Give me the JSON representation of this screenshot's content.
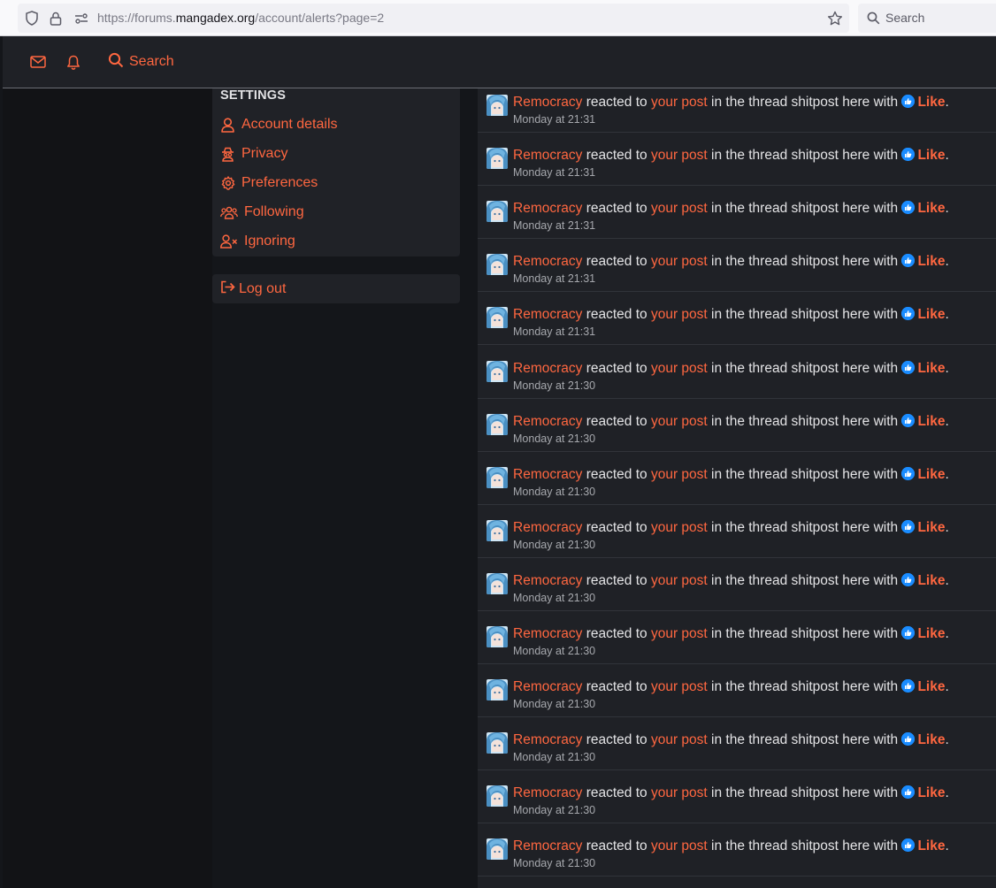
{
  "browser": {
    "url_prefix": "https://forums.",
    "url_domain": "mangadex.org",
    "url_path": "/account/alerts?page=2",
    "search_placeholder": "Search"
  },
  "nav": {
    "search_label": "Search",
    "icons": [
      "mail-icon",
      "bell-icon",
      "search-icon"
    ],
    "accent_color": "#ff6740"
  },
  "settings": {
    "title": "SETTINGS",
    "items": [
      {
        "label": "Account details",
        "icon": "user-icon"
      },
      {
        "label": "Privacy",
        "icon": "spy-icon"
      },
      {
        "label": "Preferences",
        "icon": "gear-icon"
      },
      {
        "label": "Following",
        "icon": "users-icon"
      },
      {
        "label": "Ignoring",
        "icon": "user-x-icon"
      }
    ],
    "logout_label": "Log out"
  },
  "alerts": [
    {
      "user": "Remocracy",
      "verb": "reacted to",
      "target": "your post",
      "middle": "in the thread shitpost here with",
      "reaction": "Like",
      "end": ".",
      "time": "Monday at 21:31"
    },
    {
      "user": "Remocracy",
      "verb": "reacted to",
      "target": "your post",
      "middle": "in the thread shitpost here with",
      "reaction": "Like",
      "end": ".",
      "time": "Monday at 21:31"
    },
    {
      "user": "Remocracy",
      "verb": "reacted to",
      "target": "your post",
      "middle": "in the thread shitpost here with",
      "reaction": "Like",
      "end": ".",
      "time": "Monday at 21:31"
    },
    {
      "user": "Remocracy",
      "verb": "reacted to",
      "target": "your post",
      "middle": "in the thread shitpost here with",
      "reaction": "Like",
      "end": ".",
      "time": "Monday at 21:31"
    },
    {
      "user": "Remocracy",
      "verb": "reacted to",
      "target": "your post",
      "middle": "in the thread shitpost here with",
      "reaction": "Like",
      "end": ".",
      "time": "Monday at 21:31"
    },
    {
      "user": "Remocracy",
      "verb": "reacted to",
      "target": "your post",
      "middle": "in the thread shitpost here with",
      "reaction": "Like",
      "end": ".",
      "time": "Monday at 21:30"
    },
    {
      "user": "Remocracy",
      "verb": "reacted to",
      "target": "your post",
      "middle": "in the thread shitpost here with",
      "reaction": "Like",
      "end": ".",
      "time": "Monday at 21:30"
    },
    {
      "user": "Remocracy",
      "verb": "reacted to",
      "target": "your post",
      "middle": "in the thread shitpost here with",
      "reaction": "Like",
      "end": ".",
      "time": "Monday at 21:30"
    },
    {
      "user": "Remocracy",
      "verb": "reacted to",
      "target": "your post",
      "middle": "in the thread shitpost here with",
      "reaction": "Like",
      "end": ".",
      "time": "Monday at 21:30"
    },
    {
      "user": "Remocracy",
      "verb": "reacted to",
      "target": "your post",
      "middle": "in the thread shitpost here with",
      "reaction": "Like",
      "end": ".",
      "time": "Monday at 21:30"
    },
    {
      "user": "Remocracy",
      "verb": "reacted to",
      "target": "your post",
      "middle": "in the thread shitpost here with",
      "reaction": "Like",
      "end": ".",
      "time": "Monday at 21:30"
    },
    {
      "user": "Remocracy",
      "verb": "reacted to",
      "target": "your post",
      "middle": "in the thread shitpost here with",
      "reaction": "Like",
      "end": ".",
      "time": "Monday at 21:30"
    },
    {
      "user": "Remocracy",
      "verb": "reacted to",
      "target": "your post",
      "middle": "in the thread shitpost here with",
      "reaction": "Like",
      "end": ".",
      "time": "Monday at 21:30"
    },
    {
      "user": "Remocracy",
      "verb": "reacted to",
      "target": "your post",
      "middle": "in the thread shitpost here with",
      "reaction": "Like",
      "end": ".",
      "time": "Monday at 21:30"
    },
    {
      "user": "Remocracy",
      "verb": "reacted to",
      "target": "your post",
      "middle": "in the thread shitpost here with",
      "reaction": "Like",
      "end": ".",
      "time": "Monday at 21:30"
    }
  ]
}
